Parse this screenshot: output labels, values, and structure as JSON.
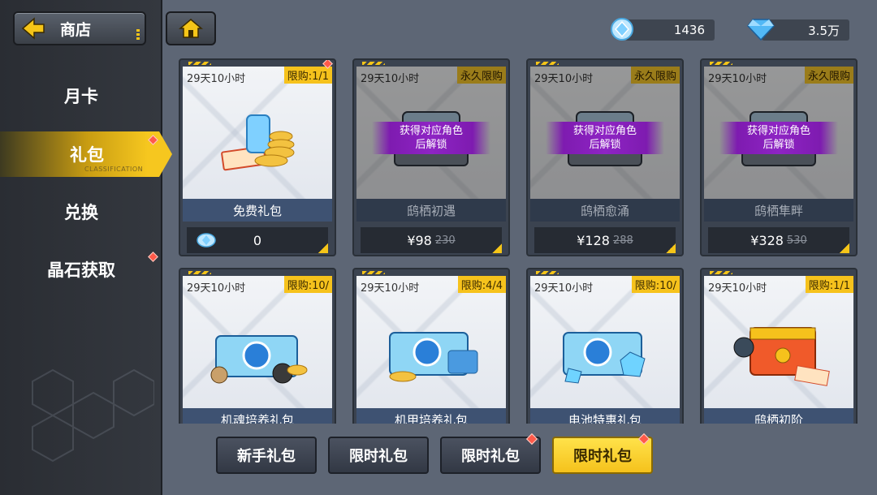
{
  "header": {
    "back_label": "商店",
    "currency": [
      {
        "icon": "crystal-icon",
        "value": "1436"
      },
      {
        "icon": "diamond-icon",
        "value": "3.5万"
      }
    ]
  },
  "sidebar": {
    "items": [
      {
        "label": "月卡"
      },
      {
        "label": "礼包",
        "sub": "CLASSIFICATION",
        "active": true
      },
      {
        "label": "兑换"
      },
      {
        "label": "晶石获取"
      }
    ]
  },
  "cards": [
    {
      "timer": "29天10小时",
      "limit": "限购:1/1",
      "name": "免费礼包",
      "price": "0",
      "old_price": "",
      "locked": false
    },
    {
      "timer": "29天10小时",
      "limit": "永久限购",
      "name": "鸱栖初遇",
      "price": "¥98",
      "old_price": "230",
      "locked": true,
      "lock_text": "获得对应角色后解锁"
    },
    {
      "timer": "29天10小时",
      "limit": "永久限购",
      "name": "鸱栖愈涌",
      "price": "¥128",
      "old_price": "288",
      "locked": true,
      "lock_text": "获得对应角色后解锁"
    },
    {
      "timer": "29天10小时",
      "limit": "永久限购",
      "name": "鸱栖隼畔",
      "price": "¥328",
      "old_price": "530",
      "locked": true,
      "lock_text": "获得对应角色后解锁"
    },
    {
      "timer": "29天10小时",
      "limit": "限购:10/",
      "name": "机魂培养礼包",
      "locked": false
    },
    {
      "timer": "29天10小时",
      "limit": "限购:4/4",
      "name": "机甲培养礼包",
      "locked": false
    },
    {
      "timer": "29天10小时",
      "limit": "限购:10/",
      "name": "电池特惠礼包",
      "locked": false
    },
    {
      "timer": "29天10小时",
      "limit": "限购:1/1",
      "name": "鸱栖初阶",
      "locked": false
    }
  ],
  "tabs": [
    {
      "label": "新手礼包",
      "active": false
    },
    {
      "label": "限时礼包",
      "active": false
    },
    {
      "label": "限时礼包",
      "active": false
    },
    {
      "label": "限时礼包",
      "active": true
    }
  ],
  "colors": {
    "accent": "#f5c21c",
    "badge": "#ff5a4a",
    "lock_ribbon": "#8e24c4"
  }
}
